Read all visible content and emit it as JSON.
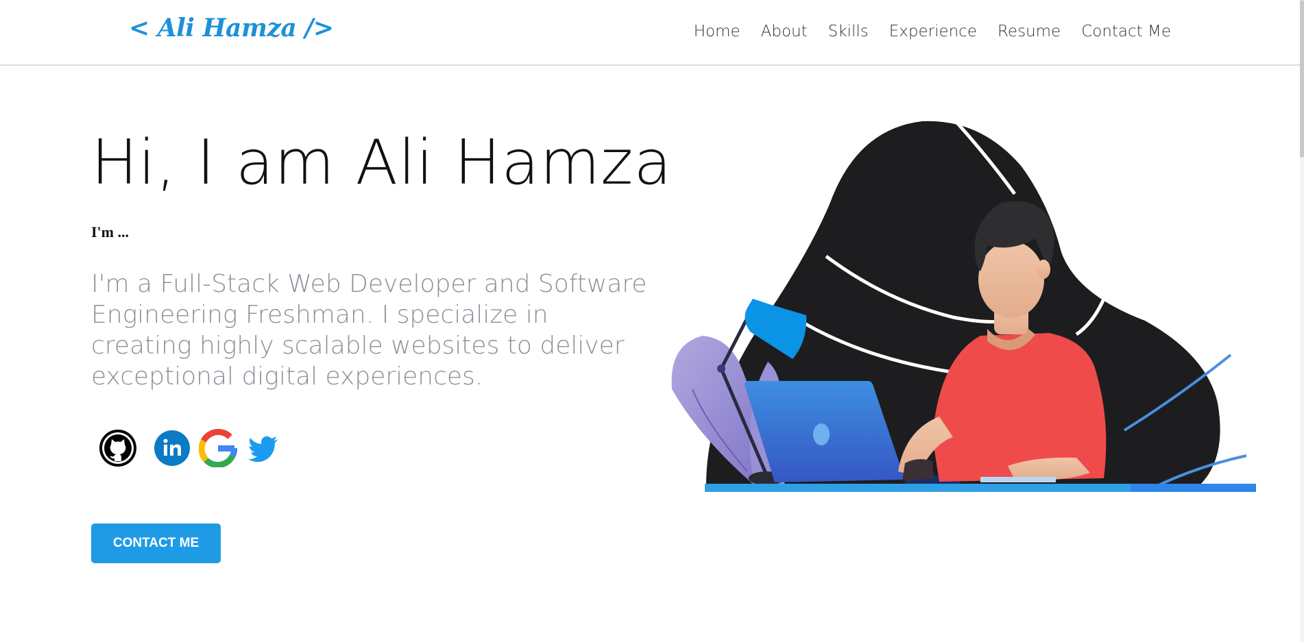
{
  "header": {
    "logo": "< Ali Hamza />",
    "nav": [
      "Home",
      "About",
      "Skills",
      "Experience",
      "Resume",
      "Contact Me"
    ]
  },
  "hero": {
    "title": "Hi, I am Ali Hamza",
    "tagline": "I'm ...",
    "description": "I'm a Full-Stack Web Developer and Software Engineering Freshman. I specialize in creating highly scalable websites to deliver exceptional digital experiences.",
    "cta_label": "CONTACT ME"
  },
  "socials": [
    "github-icon",
    "linkedin-icon",
    "google-icon",
    "twitter-icon"
  ],
  "colors": {
    "accent": "#1f9be6",
    "logo": "#1e90d8",
    "text_muted": "#8a8f98",
    "shirt": "#ef4b4b",
    "blob": "#1d1d1f"
  }
}
